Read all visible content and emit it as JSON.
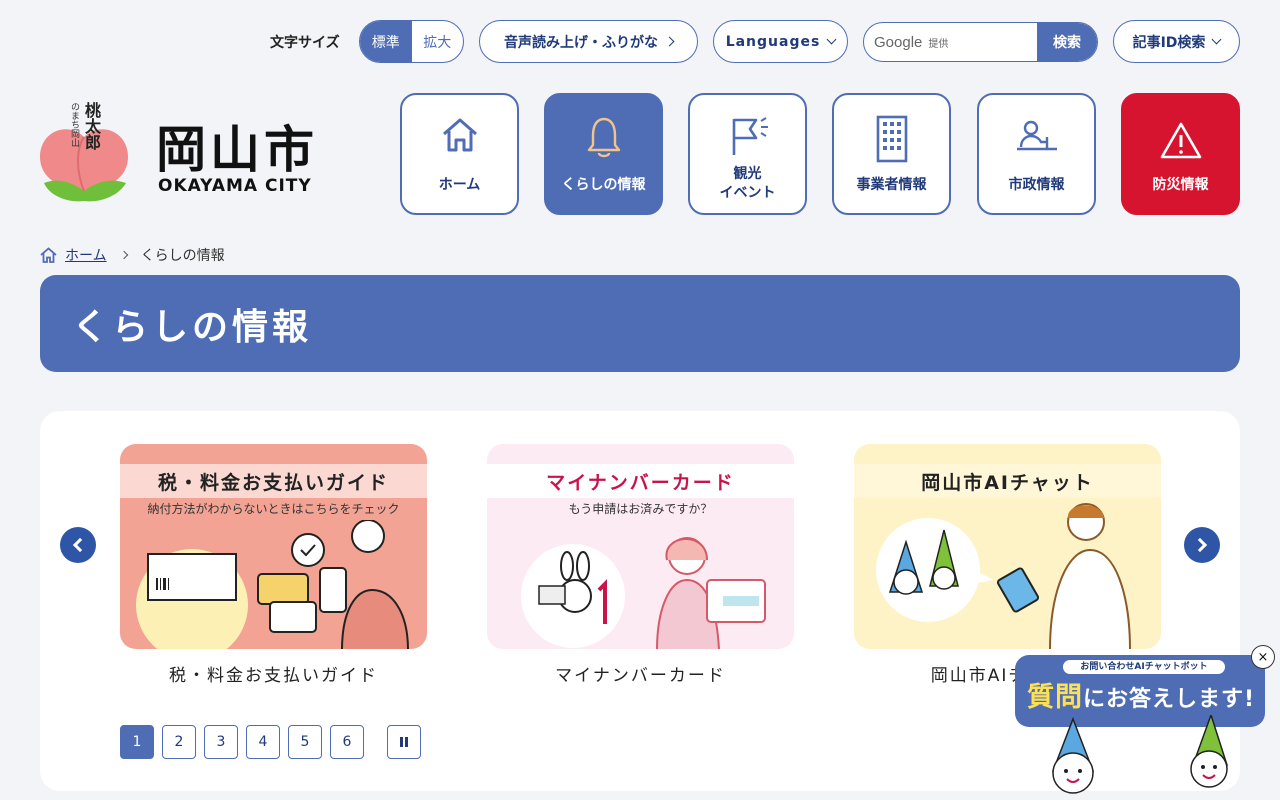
{
  "topbar": {
    "font_size_label": "文字サイズ",
    "font_size_standard": "標準",
    "font_size_large": "拡大",
    "read_aloud": "音声読み上げ・ふりがな",
    "languages": "Languages",
    "search_google": "Google",
    "search_provided": "提供",
    "search_button": "検索",
    "article_id_search": "記事ID検索"
  },
  "logo": {
    "mascot_small": "のまち岡山",
    "mascot_name": "桃太郎",
    "city_kanji": "岡山市",
    "city_en": "OKAYAMA CITY"
  },
  "nav": [
    {
      "label": "ホーム",
      "icon": "home-icon"
    },
    {
      "label": "くらしの情報",
      "icon": "bell-icon"
    },
    {
      "label": "観光\nイベント",
      "icon": "flag-icon"
    },
    {
      "label": "事業者情報",
      "icon": "building-icon"
    },
    {
      "label": "市政情報",
      "icon": "person-desk-icon"
    },
    {
      "label": "防災情報",
      "icon": "warning-icon"
    }
  ],
  "breadcrumb": {
    "home": "ホーム",
    "current": "くらしの情報"
  },
  "page_title": "くらしの情報",
  "carousel": {
    "cards": [
      {
        "image_title": "税・料金お支払いガイド",
        "image_sub": "納付方法がわからないときはこちらをチェック",
        "caption": "税・料金お支払いガイド"
      },
      {
        "image_title": "マイナンバーカード",
        "image_sub": "もう申請はお済みですか？",
        "caption": "マイナンバーカード"
      },
      {
        "image_title": "岡山市AIチャット",
        "image_sub": "",
        "caption": "岡山市AIチャット"
      }
    ],
    "pages": [
      "1",
      "2",
      "3",
      "4",
      "5",
      "6"
    ],
    "current_page": "1"
  },
  "chatbot": {
    "small": "お問い合わせAIチャットボット",
    "big_em": "質問",
    "big_rest": "にお答えします!",
    "close": "×"
  },
  "colors": {
    "primary": "#4f6db5",
    "alert": "#d7142f",
    "dark_blue": "#203a7a"
  }
}
